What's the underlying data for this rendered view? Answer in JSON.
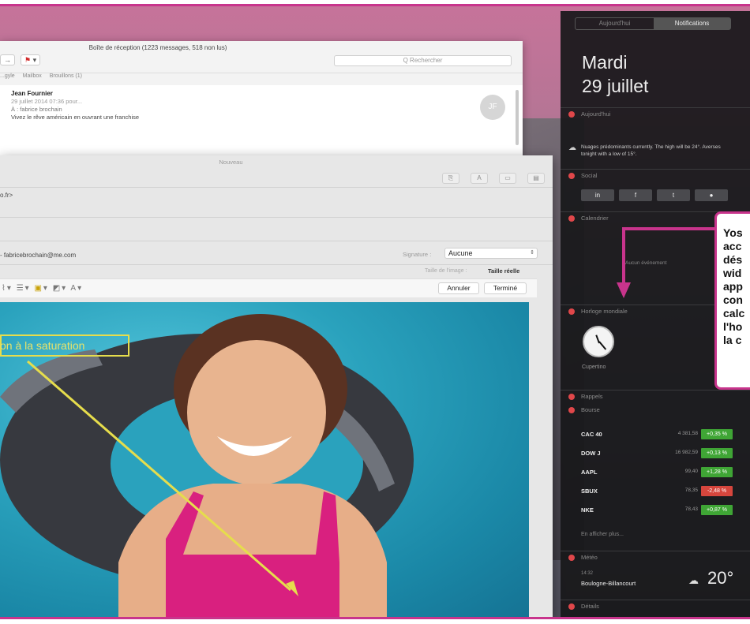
{
  "mail": {
    "title": "Boîte de réception (1223 messages, 518 non lus)",
    "search_placeholder": "Q Rechercher",
    "favorites": [
      "...gyle",
      "Mailbox",
      "Brouillons (1)"
    ],
    "message": {
      "from": "Jean Fournier",
      "date": "29 juillet 2014 07:36 pour...",
      "to": "À : fabrice brochain",
      "subject": "Vivez le rêve américain en ouvrant une franchise"
    },
    "avatar_initials": "JF"
  },
  "compose": {
    "title": "Nouveau",
    "to_fragment": "o.fr>",
    "from_value": "- fabricebrochain@me.com",
    "signature_label": "Signature :",
    "signature_value": "Aucune",
    "image_size_label": "Taille de l'image :",
    "image_size_value": "Taille réelle",
    "cancel_label": "Annuler",
    "done_label": "Terminé",
    "saturation_label": "on à la saturation"
  },
  "notification_center": {
    "tab_today": "Aujourd'hui",
    "tab_notifications": "Notifications",
    "day": "Mardi",
    "date": "29 juillet",
    "sections": {
      "today": "Aujourd'hui",
      "social": "Social",
      "calendar": "Calendrier",
      "world_clock": "Horloge mondiale",
      "reminders": "Rappels",
      "stocks": "Bourse",
      "weather": "Météo",
      "detail": "Détails"
    },
    "weather_summary": "Nuages prédominants currently. The high will be 24°. Averses tonight with a low of 15°.",
    "social_buttons": [
      "in",
      "f",
      "t",
      "●"
    ],
    "no_event": "Aucun événement",
    "clock_city": "Cupertino",
    "stocks": [
      {
        "symbol": "CAC 40",
        "price": "4 381,58",
        "change": "+0,35 %",
        "color": "#3fa535"
      },
      {
        "symbol": "DOW J",
        "price": "16 982,59",
        "change": "+0,13 %",
        "color": "#3fa535"
      },
      {
        "symbol": "AAPL",
        "price": "99,40",
        "change": "+1,28 %",
        "color": "#3fa535"
      },
      {
        "symbol": "SBUX",
        "price": "78,35",
        "change": "-2,48 %",
        "color": "#d6463d"
      },
      {
        "symbol": "NKE",
        "price": "78,43",
        "change": "+0,87 %",
        "color": "#3fa535"
      }
    ],
    "more_label": "En afficher plus...",
    "weather_time": "14:32",
    "weather_city": "Boulogne-Billancourt",
    "weather_temp": "20°"
  },
  "callout": {
    "lines": [
      "Yos",
      "acc",
      "dés",
      "wid",
      "app",
      "con",
      "calc",
      "l'ho",
      "la c"
    ]
  },
  "colors": {
    "accent_pink": "#c8348c",
    "yellow_annotation": "#e6dd4c"
  }
}
